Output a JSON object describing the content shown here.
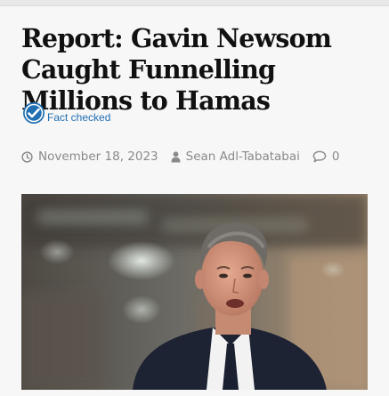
{
  "article": {
    "headline": "Report: Gavin Newsom Caught Funnelling Millions to Hamas",
    "fact_check": {
      "label": "Fact checked",
      "icon": "check-badge-icon",
      "color": "#1f6fb2"
    },
    "meta": {
      "date": "November 18, 2023",
      "date_icon": "clock-icon",
      "author": "Sean Adl-Tabatabai",
      "author_icon": "person-icon",
      "comments": "0",
      "comments_icon": "comment-icon"
    },
    "image": {
      "icon": "article-photo"
    }
  },
  "colors": {
    "headline": "#111111",
    "meta": "#8a8a8a",
    "accent": "#1f6fb2",
    "background": "#f7f7f7"
  }
}
